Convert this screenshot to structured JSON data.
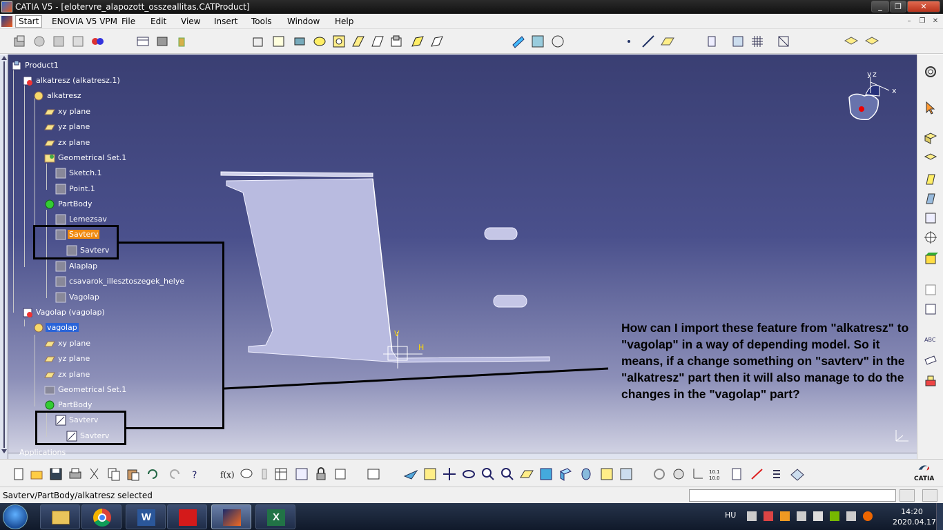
{
  "window": {
    "title": "CATIA V5 - [elotervre_alapozott_osszeallitas.CATProduct]",
    "minimize": "_",
    "maximize": "❐",
    "close": "✕"
  },
  "menu": {
    "start": "Start",
    "enovia": "ENOVIA V5 VPM",
    "file": "File",
    "edit": "Edit",
    "view": "View",
    "insert": "Insert",
    "tools": "Tools",
    "window": "Window",
    "help": "Help"
  },
  "tree": {
    "product": "Product1",
    "part1_instance": "alkatresz (alkatresz.1)",
    "part1": "alkatresz",
    "xy": "xy plane",
    "yz": "yz plane",
    "zx": "zx plane",
    "geoset": "Geometrical Set.1",
    "sketch": "Sketch.1",
    "point": "Point.1",
    "partbody": "PartBody",
    "lemezsav": "Lemezsav",
    "savterv": "Savterv",
    "savterv_child": "Savterv",
    "alaplap": "Alaplap",
    "csavarok": "csavarok_illesztoszegek_helye",
    "vagolap_body": "Vagolap",
    "part2_instance": "Vagolap (vagolap)",
    "part2": "vagolap",
    "xy2": "xy plane",
    "yz2": "yz plane",
    "zx2": "zx plane",
    "geoset2": "Geometrical Set.1",
    "partbody2": "PartBody",
    "savterv2": "Savterv",
    "savterv2_child": "Savterv",
    "applications": "Applications"
  },
  "viewport": {
    "sketch_v": "V",
    "sketch_h": "H",
    "compass_y": "y",
    "compass_z": "z",
    "compass_x": "x",
    "corner_axes": "Yz x"
  },
  "question": "How can I import these feature from \"alkatresz\" to \"vagolap\" in a way of depending model. So it means, if a change something on \"savterv\" in the \"alkatresz\" part then it will also manage to do the changes in the \"vagolap\" part?",
  "status": {
    "text": "Savterv/PartBody/alkatresz selected",
    "command": ""
  },
  "taskbar": {
    "lang": "HU",
    "time": "14:20",
    "date": "2020.04.17.",
    "apps": [
      "explorer-icon",
      "chrome-icon",
      "word-icon",
      "acrobat-icon",
      "catia-icon",
      "excel-icon"
    ]
  },
  "catia_logo": "CATIA",
  "colors": {
    "selection_orange": "#f08a10",
    "selection_blue": "#2a64d8",
    "background_top": "#3a3f73",
    "background_bottom": "#d6d7e6"
  }
}
